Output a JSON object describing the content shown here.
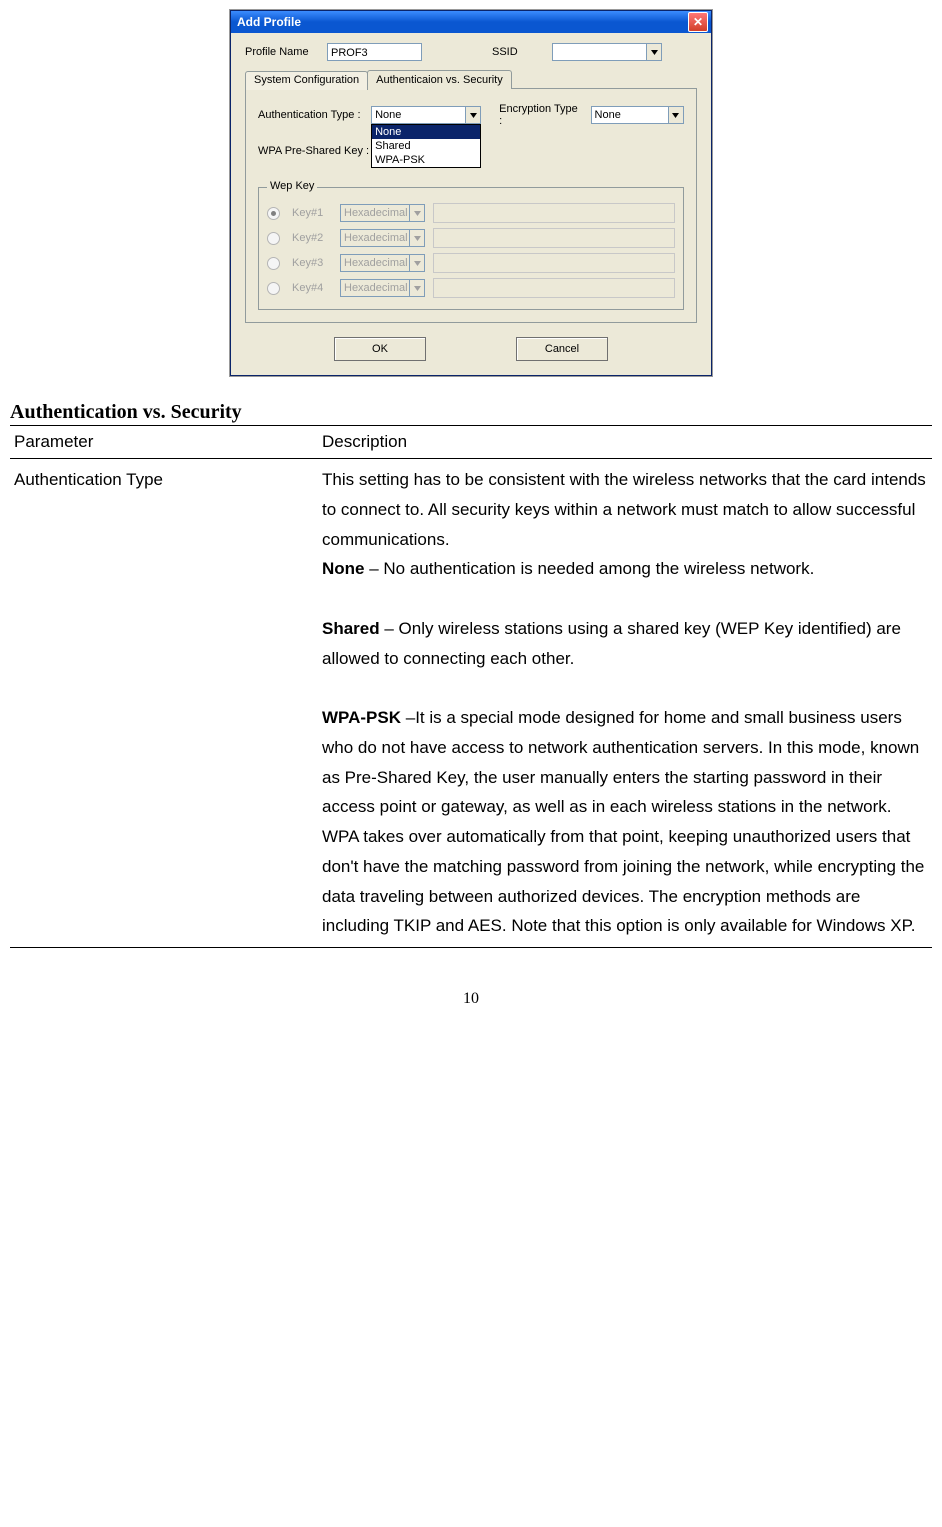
{
  "dialog": {
    "title": "Add Profile",
    "profile_name_label": "Profile Name",
    "profile_name_value": "PROF3",
    "ssid_label": "SSID",
    "ssid_value": "",
    "tab_sys": "System Configuration",
    "tab_auth": "Authenticaion vs. Security",
    "auth_type_label": "Authentication Type :",
    "auth_type_value": "None",
    "auth_type_options": [
      "None",
      "Shared",
      "WPA-PSK"
    ],
    "enc_type_label": "Encryption Type :",
    "enc_type_value": "None",
    "wpa_psk_label": "WPA Pre-Shared Key :",
    "wep_legend": "Wep Key",
    "wep_keys": [
      {
        "label": "Key#1",
        "format": "Hexadecimal",
        "selected": true
      },
      {
        "label": "Key#2",
        "format": "Hexadecimal",
        "selected": false
      },
      {
        "label": "Key#3",
        "format": "Hexadecimal",
        "selected": false
      },
      {
        "label": "Key#4",
        "format": "Hexadecimal",
        "selected": false
      }
    ],
    "ok": "OK",
    "cancel": "Cancel"
  },
  "doc": {
    "section_title": "Authentication vs. Security",
    "col_param": "Parameter",
    "col_desc": "Description",
    "row_param": "Authentication Type",
    "desc_intro": "This setting has to be consistent with the wireless networks that the card intends to connect to.    All security keys within a network must match to allow successful communications.",
    "none_label": "None",
    "none_text": " – No authentication is needed among the wireless network.",
    "shared_label": "Shared",
    "shared_text": " – Only wireless stations using a shared key (WEP Key identified) are allowed to connecting each other.",
    "wpa_label": "WPA-PSK",
    "wpa_text": " –It is a special mode designed for home and small business users who do not have access to network authentication servers. In this mode, known as Pre-Shared Key, the user manually enters the starting password in their access point or gateway, as well as in each wireless stations in the network. WPA takes over automatically from that point, keeping unauthorized users that don't have the matching password from joining the network, while encrypting the data traveling between authorized devices. The encryption methods are including TKIP and AES. Note that this option is only available for Windows XP.",
    "page_number": "10"
  }
}
